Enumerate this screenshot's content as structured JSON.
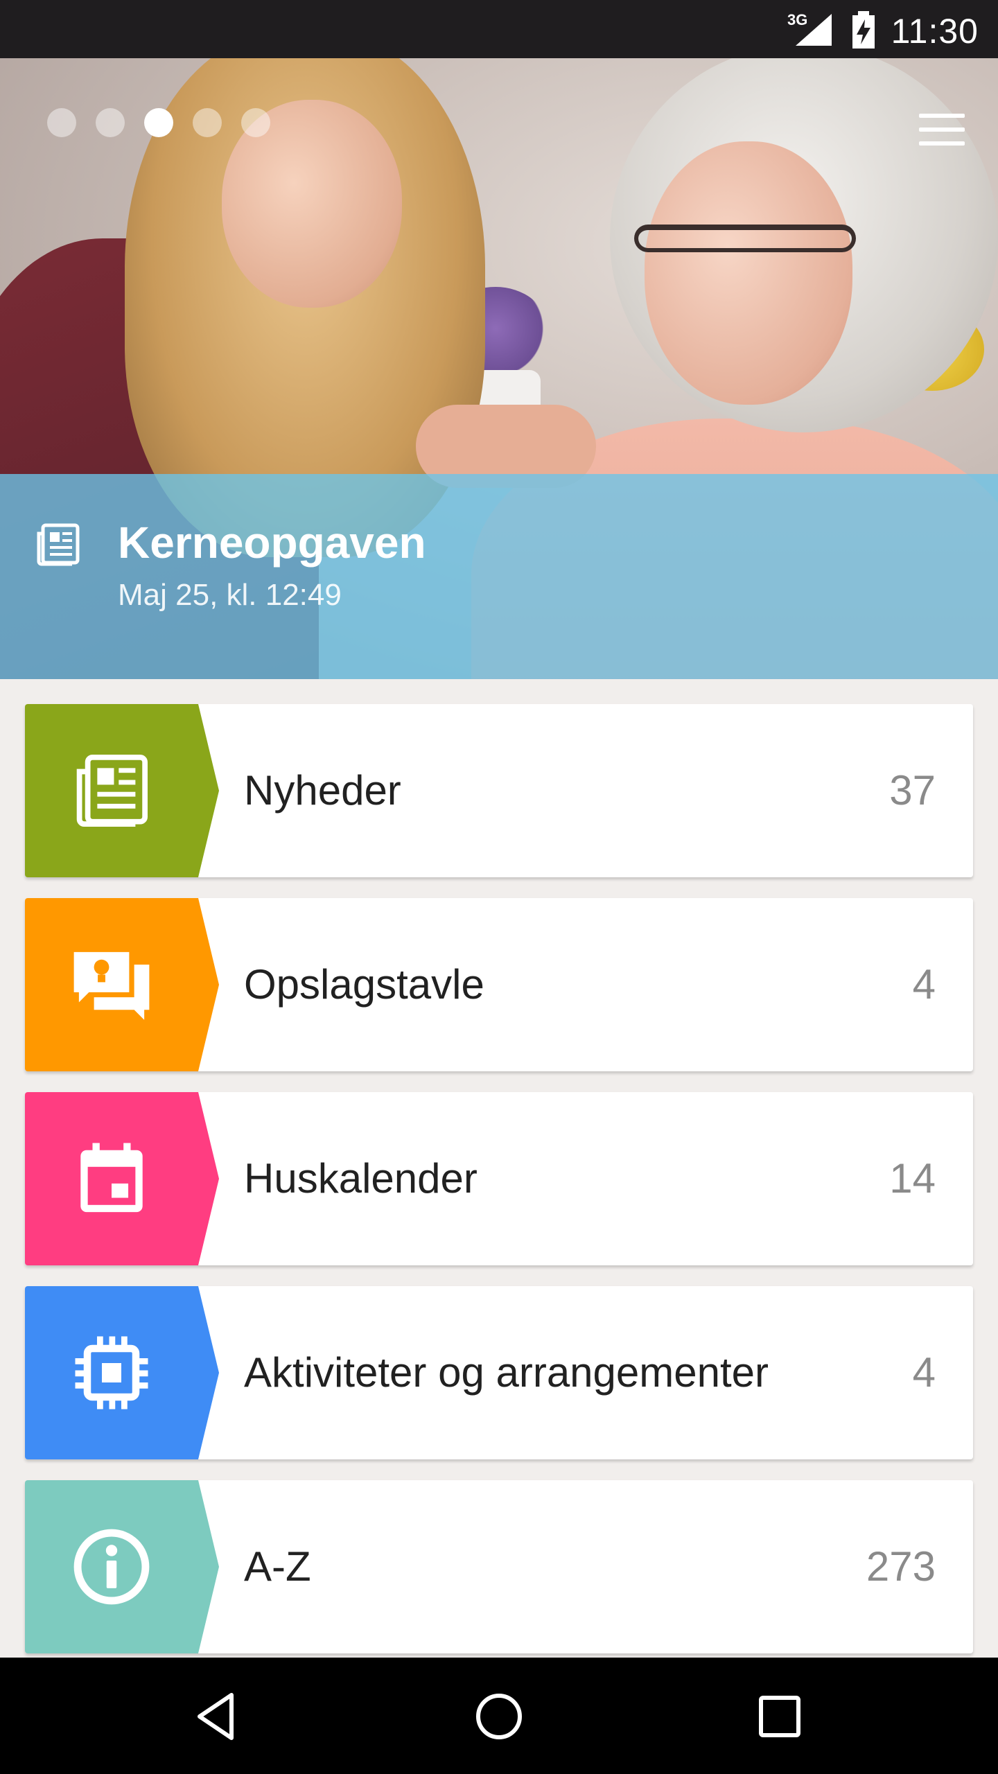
{
  "status_bar": {
    "network": "3G",
    "time": "11:30"
  },
  "carousel": {
    "dot_count": 5,
    "active_index": 2
  },
  "featured": {
    "title": "Kerneopgaven",
    "subtitle": "Maj 25, kl. 12:49",
    "icon": "newspaper-icon",
    "overlay_color": "#6bc4e8"
  },
  "menu_items": [
    {
      "label": "Nyheder",
      "count": "37",
      "icon": "newspaper-icon",
      "color": "#8aa61a"
    },
    {
      "label": "Opslagstavle",
      "count": "4",
      "icon": "bulletin-chat-icon",
      "color": "#ff9800"
    },
    {
      "label": "Huskalender",
      "count": "14",
      "icon": "calendar-icon",
      "color": "#ff3d81"
    },
    {
      "label": "Aktiviteter og arrangementer",
      "count": "4",
      "icon": "activity-chip-icon",
      "color": "#3f8cf5"
    },
    {
      "label": "A-Z",
      "count": "273",
      "icon": "info-icon",
      "color": "#7dcbbf"
    }
  ],
  "nav_bar": {
    "back": "back-icon",
    "home": "home-icon",
    "recents": "recents-icon"
  }
}
